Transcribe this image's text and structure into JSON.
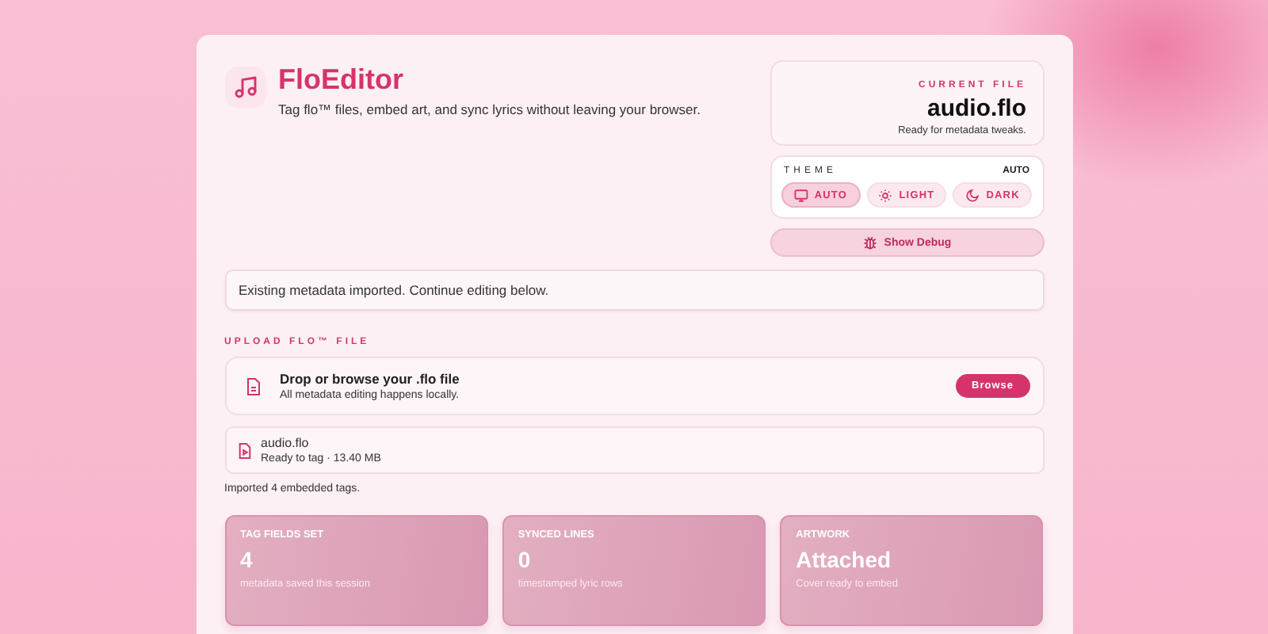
{
  "app": {
    "title": "FloEditor",
    "tagline": "Tag flo™ files, embed art, and sync lyrics without leaving your browser."
  },
  "current_file": {
    "label": "CURRENT FILE",
    "name": "audio.flo",
    "status": "Ready for metadata tweaks."
  },
  "theme": {
    "label": "THEME",
    "value": "AUTO",
    "options": [
      {
        "label": "AUTO",
        "kind": "monitor",
        "selected": true
      },
      {
        "label": "LIGHT",
        "kind": "sun",
        "selected": false
      },
      {
        "label": "DARK",
        "kind": "moon",
        "selected": false
      }
    ]
  },
  "debug_button": "Show Debug",
  "notice": "Existing metadata imported. Continue editing below.",
  "upload": {
    "section_label": "UPLOAD FLO™ FILE",
    "title": "Drop or browse your .flo file",
    "subtitle": "All metadata editing happens locally.",
    "button": "Browse"
  },
  "file": {
    "name": "audio.flo",
    "meta": "Ready to tag · 13.40 MB"
  },
  "import_status": "Imported 4 embedded tags.",
  "stats": [
    {
      "label": "TAG FIELDS SET",
      "value": "4",
      "caption": "metadata saved this session"
    },
    {
      "label": "SYNCED LINES",
      "value": "0",
      "caption": "timestamped lyric rows"
    },
    {
      "label": "ARTWORK",
      "value": "Attached",
      "caption": "Cover ready to embed"
    }
  ]
}
